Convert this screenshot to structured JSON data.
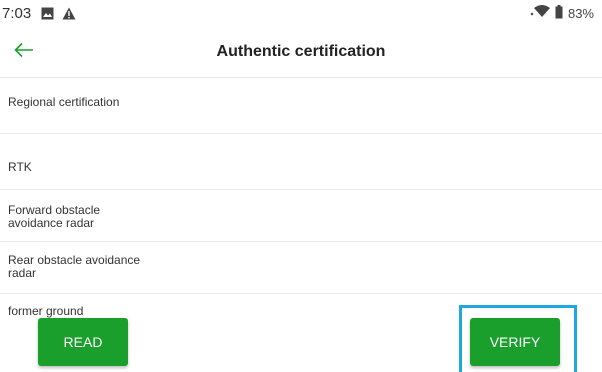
{
  "status_bar": {
    "time": "7:03",
    "battery": "83%",
    "icons": [
      "image-icon",
      "warning-icon",
      "wifi-icon",
      "battery-icon"
    ]
  },
  "header": {
    "title": "Authentic certification",
    "back_icon": "arrow-left-icon",
    "accent_color": "#1a9e2c"
  },
  "items": [
    {
      "label": "Regional certification"
    },
    {
      "label": "RTK"
    },
    {
      "label": "Forward obstacle avoidance radar"
    },
    {
      "label": "Rear obstacle avoidance radar"
    },
    {
      "label": "former ground"
    }
  ],
  "buttons": {
    "read": "READ",
    "verify": "VERIFY",
    "button_color": "#1a9e2c",
    "highlight_color": "#1fa7e0"
  }
}
